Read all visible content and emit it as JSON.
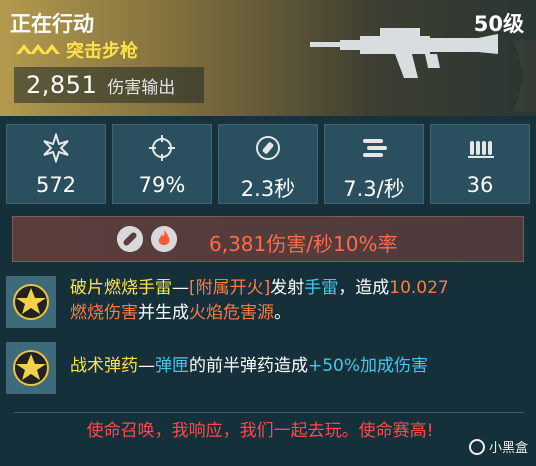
{
  "header": {
    "title": "正在行动",
    "level": "50级",
    "weapon_type": "突击步枪",
    "damage_value": "2,851",
    "damage_label": "伤害输出",
    "accent_color": "#ffe24a"
  },
  "stats": [
    {
      "icon": "burst-icon",
      "value": "572"
    },
    {
      "icon": "crosshair-icon",
      "value": "79%"
    },
    {
      "icon": "reload-icon",
      "value": "2.3秒"
    },
    {
      "icon": "bullets-icon",
      "value": "7.3/秒"
    },
    {
      "icon": "magazine-icon",
      "value": "36"
    }
  ],
  "dps": {
    "text": "6,381伤害/秒10%率",
    "icons": [
      "bullet-element-icon",
      "fire-element-icon"
    ]
  },
  "perks": [
    {
      "icon": "star-badge-icon",
      "name": "破片燃烧手雷",
      "dash": "—",
      "tag": "[附属开火]",
      "p1": "发射",
      "p2": "手雷",
      "p3": "，造成",
      "p4": "10.027",
      "p5": "燃烧伤害",
      "p6": "并生成",
      "p7": "火焰危害源",
      "p8": "。"
    },
    {
      "icon": "star-badge-icon",
      "name": "战术弹药",
      "dash": "—",
      "p1": "弹匣",
      "p2": "的前半弹药造成",
      "p3": "+50%加成伤害"
    }
  ],
  "quote": "使命召唤，我响应，我们一起去玩。使命赛高!",
  "watermark": "小黑盒"
}
